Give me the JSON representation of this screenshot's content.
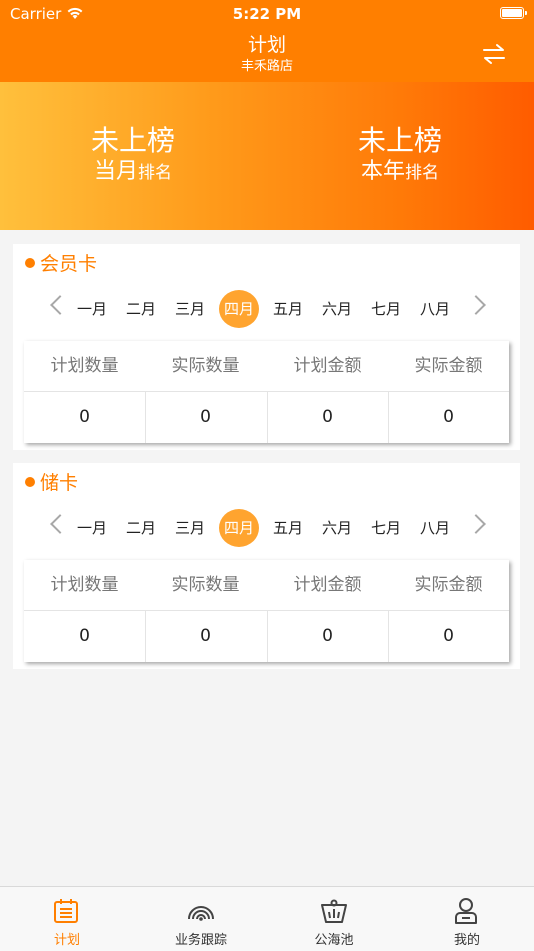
{
  "status_bar": {
    "carrier": "Carrier",
    "time": "5:22 PM"
  },
  "nav": {
    "title": "计划",
    "subtitle": "丰禾路店",
    "swap_icon": "swap-arrows-icon"
  },
  "banner": {
    "month_rank": {
      "value": "未上榜",
      "prefix": "当月",
      "suffix": "排名"
    },
    "year_rank": {
      "value": "未上榜",
      "prefix": "本年",
      "suffix": "排名"
    }
  },
  "months": [
    "一月",
    "二月",
    "三月",
    "四月",
    "五月",
    "六月",
    "七月",
    "八月"
  ],
  "sections": [
    {
      "title": "会员卡",
      "selected_month": "四月",
      "headers": [
        "计划数量",
        "实际数量",
        "计划金额",
        "实际金额"
      ],
      "values": [
        "0",
        "0",
        "0",
        "0"
      ]
    },
    {
      "title": "储卡",
      "selected_month": "四月",
      "headers": [
        "计划数量",
        "实际数量",
        "计划金额",
        "实际金额"
      ],
      "values": [
        "0",
        "0",
        "0",
        "0"
      ]
    }
  ],
  "tabs": [
    {
      "label": "计划",
      "icon": "calendar-list-icon",
      "active": true
    },
    {
      "label": "业务跟踪",
      "icon": "radar-icon",
      "active": false
    },
    {
      "label": "公海池",
      "icon": "pool-basket-icon",
      "active": false
    },
    {
      "label": "我的",
      "icon": "user-profile-icon",
      "active": false
    }
  ],
  "colors": {
    "accent": "#ff7f00",
    "month_highlight": "#ffa42f",
    "banner_start": "#ffc03c",
    "banner_end": "#ff5c00"
  }
}
